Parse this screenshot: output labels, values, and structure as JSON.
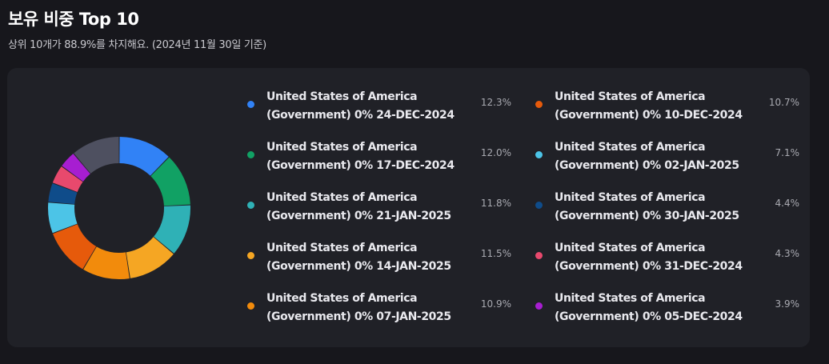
{
  "header": {
    "title": "보유 비중 Top 10",
    "subtitle": "상위 10개가 88.9%를 차지해요. (2024년 11월 30일 기준)"
  },
  "chart_data": {
    "type": "pie",
    "donut": true,
    "legend_position": "right",
    "series": [
      {
        "name": "United States of America (Government) 0% 24-DEC-2024",
        "value": 12.3,
        "label": "12.3%",
        "color": "#3182f6"
      },
      {
        "name": "United States of America (Government) 0% 17-DEC-2024",
        "value": 12.0,
        "label": "12.0%",
        "color": "#11a164"
      },
      {
        "name": "United States of America (Government) 0% 21-JAN-2025",
        "value": 11.8,
        "label": "11.8%",
        "color": "#2fb1b6"
      },
      {
        "name": "United States of America (Government) 0% 14-JAN-2025",
        "value": 11.5,
        "label": "11.5%",
        "color": "#f5a623"
      },
      {
        "name": "United States of America (Government) 0% 07-JAN-2025",
        "value": 10.9,
        "label": "10.9%",
        "color": "#f28b0c"
      },
      {
        "name": "United States of America (Government) 0% 10-DEC-2024",
        "value": 10.7,
        "label": "10.7%",
        "color": "#e65a0b"
      },
      {
        "name": "United States of America (Government) 0% 02-JAN-2025",
        "value": 7.1,
        "label": "7.1%",
        "color": "#4cc4e7"
      },
      {
        "name": "United States of America (Government) 0% 30-JAN-2025",
        "value": 4.4,
        "label": "4.4%",
        "color": "#0f4c8a"
      },
      {
        "name": "United States of America (Government) 0% 31-DEC-2024",
        "value": 4.3,
        "label": "4.3%",
        "color": "#e8496d"
      },
      {
        "name": "United States of America (Government) 0% 05-DEC-2024",
        "value": 3.9,
        "label": "3.9%",
        "color": "#a71ed1"
      }
    ],
    "remainder": {
      "value": 11.1,
      "color": "#4e5060"
    }
  }
}
